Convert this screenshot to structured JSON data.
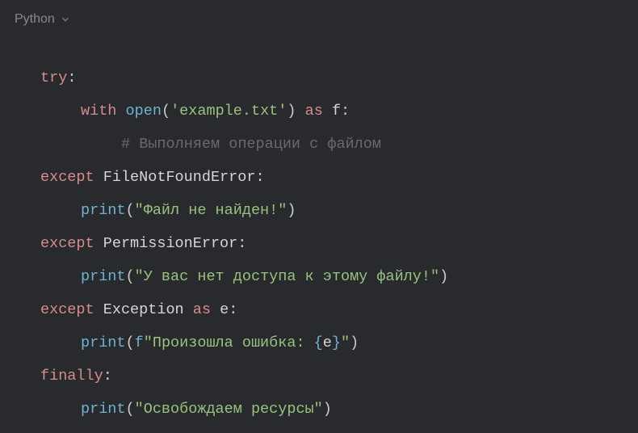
{
  "header": {
    "language_label": "Python"
  },
  "code": {
    "l1_try": "try",
    "l1_colon": ":",
    "l2_with": "with",
    "l2_open": "open",
    "l2_str": "'example.txt'",
    "l2_as": "as",
    "l2_var": "f",
    "l2_colon": ":",
    "l3_comment": "# Выполняем операции с файлом",
    "l4_except": "except",
    "l4_cls": "FileNotFoundError",
    "l4_colon": ":",
    "l5_print": "print",
    "l5_str": "\"Файл не найден!\"",
    "l6_except": "except",
    "l6_cls": "PermissionError",
    "l6_colon": ":",
    "l7_print": "print",
    "l7_str": "\"У вас нет доступа к этому файлу!\"",
    "l8_except": "except",
    "l8_cls": "Exception",
    "l8_as": "as",
    "l8_var": "e",
    "l8_colon": ":",
    "l9_print": "print",
    "l9_f": "f",
    "l9_str1": "\"Произошла ошибка: ",
    "l9_brace_open": "{",
    "l9_evar": "e",
    "l9_brace_close": "}",
    "l9_str2": "\"",
    "l10_finally": "finally",
    "l10_colon": ":",
    "l11_print": "print",
    "l11_str": "\"Освобождаем ресурсы\"",
    "paren_open": "(",
    "paren_close": ")"
  }
}
